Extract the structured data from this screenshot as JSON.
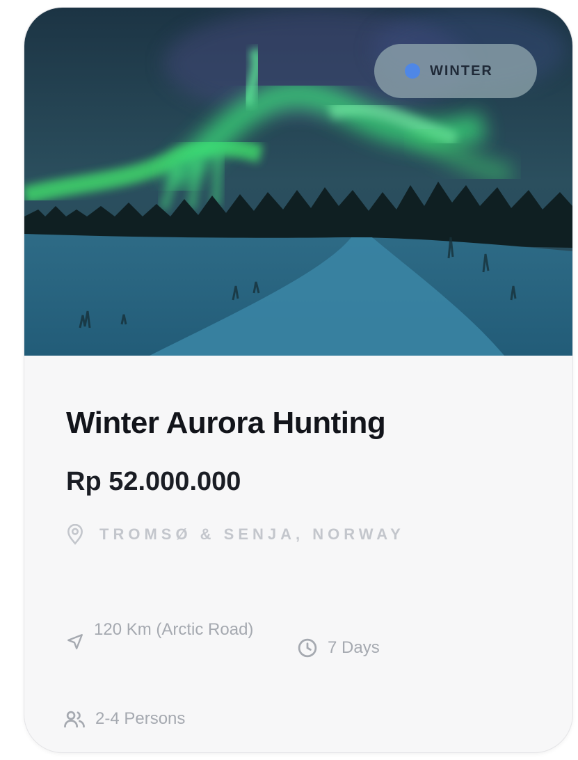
{
  "card": {
    "image_alt": "Aurora over a snowy road with a pine forest",
    "badge": {
      "label": "WINTER",
      "icon": "dot-icon",
      "dot_color": "#4f87e6"
    },
    "title": "Winter Aurora Hunting",
    "price": "Rp 52.000.000",
    "location": {
      "icon": "map-pin-icon",
      "text": "TROMSØ & SENJA, NORWAY"
    },
    "details": {
      "distance": {
        "icon": "navigation-arrow-icon",
        "text": "120 Km (Arctic Road)"
      },
      "duration": {
        "icon": "clock-icon",
        "text": "7 Days"
      },
      "persons": {
        "icon": "users-icon",
        "text": "2-4 Persons"
      }
    }
  }
}
